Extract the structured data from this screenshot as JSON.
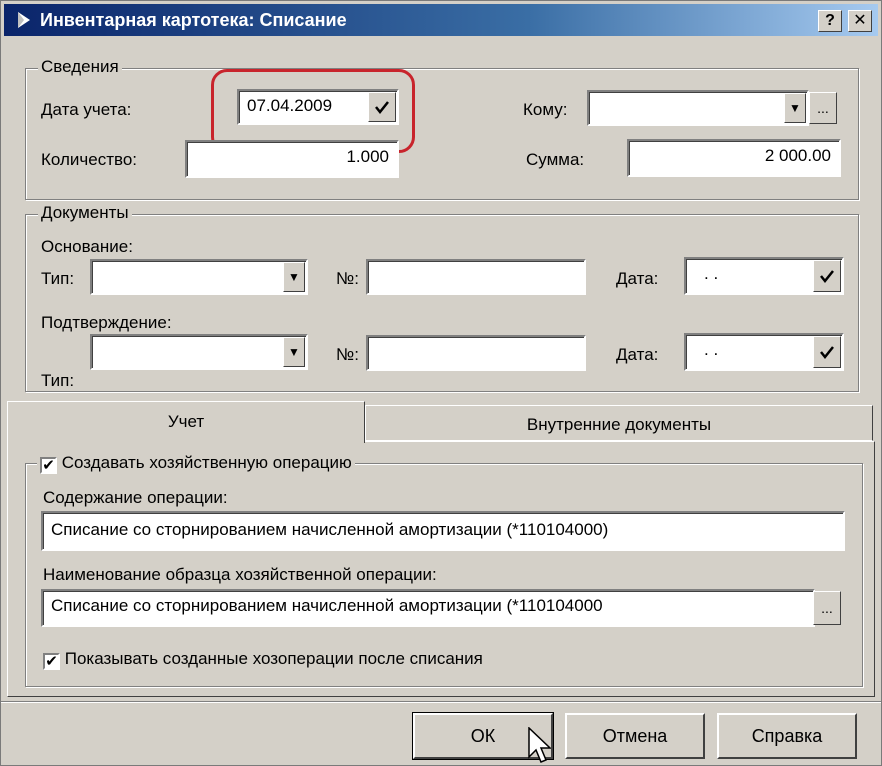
{
  "window": {
    "title": "Инвентарная картотека: Списание",
    "help_label": "?",
    "close_label": "✕"
  },
  "svedenia": {
    "group_label": "Сведения",
    "date_label": "Дата учета:",
    "date_value": "07.04.2009",
    "kому_label": "Кому:",
    "komu_value": "",
    "qty_label": "Количество:",
    "qty_value": "1.000",
    "sum_label": "Сумма:",
    "sum_value": "2 000.00"
  },
  "documents": {
    "group_label": "Документы",
    "osnovanie_label": "Основание:",
    "type_label": "Тип:",
    "number_label": "№:",
    "date_label": "Дата:",
    "osnovanie_date": ".  .",
    "podtverzhdenie_label": "Подтверждение:",
    "type2_label": "Тип:",
    "number2_label": "№:",
    "date2_label": "Дата:",
    "podtverzhdenie_date": ".  ."
  },
  "tabs": [
    {
      "label": "Учет"
    },
    {
      "label": "Внутренние документы"
    }
  ],
  "uchet": {
    "create_op_label": "Создавать хозяйственную операцию",
    "content_label": "Содержание операции:",
    "content_value": "Списание со сторнированием начисленной амортизации (*110104000)",
    "template_label": "Наименование образца хозяйственной операции:",
    "template_value": "Списание со сторнированием начисленной амортизации (*110104000",
    "show_ops_label": "Показывать созданные хозоперации после списания"
  },
  "buttons": {
    "ok": "ОК",
    "cancel": "Отмена",
    "help": "Справка"
  },
  "colors": {
    "highlight": "#c8242c",
    "titlebar": "#0a246a"
  }
}
